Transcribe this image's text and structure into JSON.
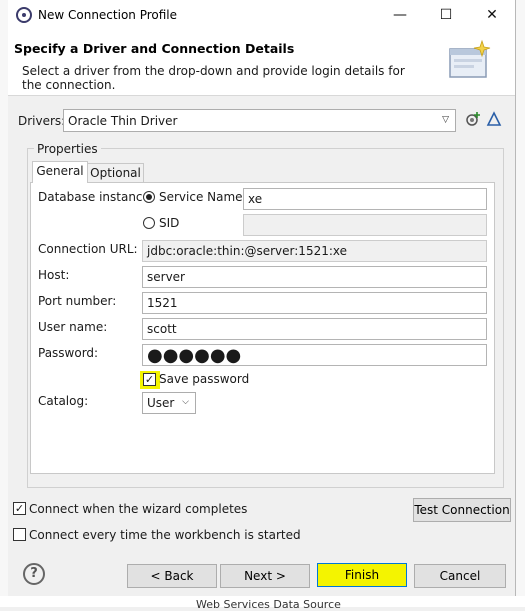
{
  "window": {
    "title": "New Connection Profile",
    "controls": [
      "—",
      "☐",
      "✕"
    ]
  },
  "banner": {
    "title": "Specify a Driver and Connection Details",
    "description": "Select a driver from the drop-down and provide login details for the connection."
  },
  "drivers": {
    "label": "Drivers:",
    "selected": "Oracle Thin Driver"
  },
  "properties": {
    "legend": "Properties",
    "tabs": [
      "General",
      "Optional"
    ],
    "active_tab": "General",
    "database_instance": {
      "label": "Database instance:",
      "service_name_label": "Service Name",
      "service_name_value": "xe",
      "sid_label": "SID",
      "sid_value": ""
    },
    "connection_url": {
      "label": "Connection URL:",
      "value": "jdbc:oracle:thin:@server:1521:xe"
    },
    "host": {
      "label": "Host:",
      "value": "server"
    },
    "port": {
      "label": "Port number:",
      "value": "1521"
    },
    "user": {
      "label": "User name:",
      "value": "scott"
    },
    "password": {
      "label": "Password:",
      "masked": "●●●●●●"
    },
    "save_password": {
      "label": "Save password",
      "checked": true
    },
    "catalog": {
      "label": "Catalog:",
      "selected": "User"
    }
  },
  "options": {
    "connect_when_complete": {
      "label": "Connect when the wizard completes",
      "checked": true
    },
    "connect_every_time": {
      "label": "Connect every time the workbench is started",
      "checked": false
    },
    "test_connection": "Test Connection"
  },
  "footer": {
    "back": "< Back",
    "next": "Next >",
    "finish": "Finish",
    "cancel": "Cancel"
  },
  "background": {
    "bottom_text": "Web Services Data Source"
  },
  "colors": {
    "highlight": "#f4f400",
    "focus_border": "#0078d7"
  }
}
